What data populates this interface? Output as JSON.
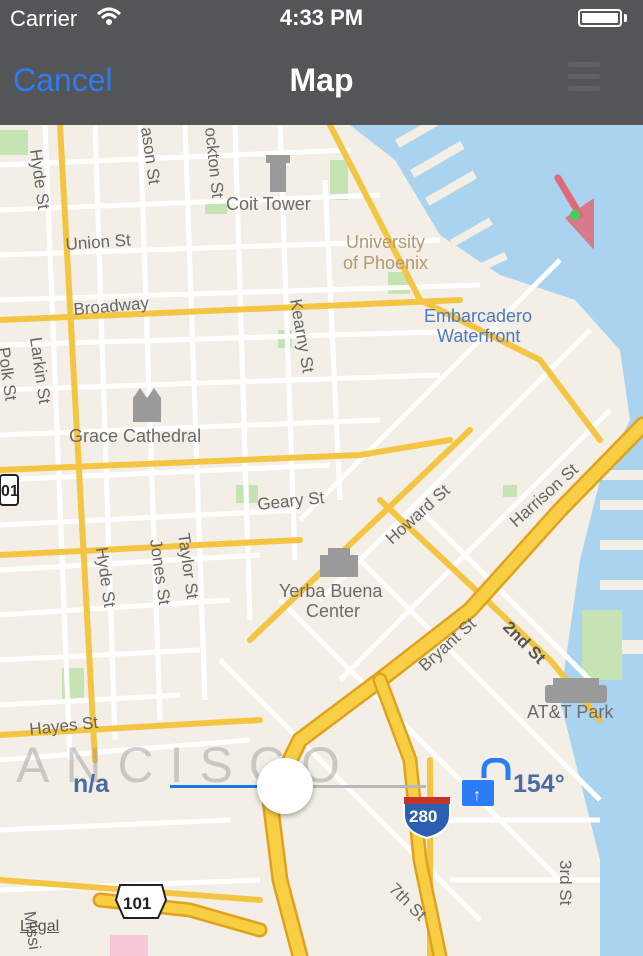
{
  "status_bar": {
    "carrier": "Carrier",
    "time": "4:33 PM"
  },
  "nav_bar": {
    "cancel_label": "Cancel",
    "title": "Map"
  },
  "map": {
    "labels": {
      "coit_tower": "Coit Tower",
      "univ_phoenix_1": "University",
      "univ_phoenix_2": "of Phoenix",
      "embarcadero_1": "Embarcadero",
      "embarcadero_2": "Waterfront",
      "grace_cathedral": "Grace Cathedral",
      "yerba_buena_1": "Yerba Buena",
      "yerba_buena_2": "Center",
      "att_park": "AT&T Park",
      "city_name": "ANCISCO",
      "streets": {
        "hyde_top": "Hyde St",
        "mason": "ason St",
        "stockton": "ockton St",
        "union": "Union St",
        "broadway": "Broadway",
        "kearny": "Kearny St",
        "larkin": "Larkin St",
        "polk": "Polk St",
        "geary": "Geary St",
        "howard": "Howard St",
        "harrison": "Harrison St",
        "hyde_bottom": "Hyde St",
        "jones": "Jones St",
        "taylor": "Taylor St",
        "bryant": "Bryant St",
        "second": "2nd St",
        "hayes": "Hayes St",
        "seventh": "7th St",
        "third": "3rd St",
        "mission": "Missi"
      },
      "shields": {
        "us101_left": "01",
        "i280": "280",
        "us101": "101"
      }
    },
    "legal_label": "Legal"
  },
  "controls": {
    "distance_label": "n/a",
    "slider_value": 0.45,
    "heading_label": "154°"
  },
  "colors": {
    "water": "#a9d3ee",
    "land": "#f3efe6",
    "park": "#c6e3b4",
    "major_road": "#f4c542",
    "minor_road": "#ffffff",
    "accent": "#2c7cf6",
    "marker": "#e06a78"
  }
}
